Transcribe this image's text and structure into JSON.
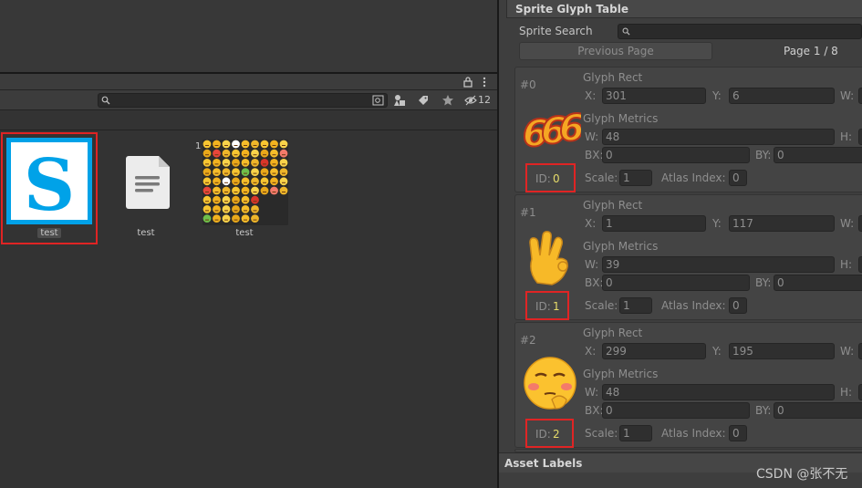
{
  "project": {
    "hidden_count": "12",
    "search_value": "",
    "assets": [
      {
        "label": "test",
        "kind": "sprite",
        "letter": "S"
      },
      {
        "label": "test",
        "kind": "document"
      },
      {
        "label": "test",
        "kind": "texture",
        "badge": "1"
      }
    ]
  },
  "inspector": {
    "title": "Sprite Glyph Table",
    "search_label": "Sprite Search",
    "search_value": "",
    "prev_page": "Previous Page",
    "page_label": "Page 1 / 8",
    "section_rect": "Glyph Rect",
    "section_metrics": "Glyph Metrics",
    "labels": {
      "x": "X:",
      "y": "Y:",
      "w": "W:",
      "h": "H:",
      "bx": "BX:",
      "by": "BY:",
      "id": "ID:",
      "scale": "Scale:",
      "atlas": "Atlas Index:"
    },
    "glyphs": [
      {
        "index": "#0",
        "id": "0",
        "x": "301",
        "y": "6",
        "w": "48",
        "bx": "0",
        "by": "0",
        "scale": "1",
        "atlas": "0",
        "image": "666-emoji"
      },
      {
        "index": "#1",
        "id": "1",
        "x": "1",
        "y": "117",
        "w": "39",
        "bx": "0",
        "by": "0",
        "scale": "1",
        "atlas": "0",
        "image": "ok-hand-emoji"
      },
      {
        "index": "#2",
        "id": "2",
        "x": "299",
        "y": "195",
        "w": "48",
        "bx": "0",
        "by": "0",
        "scale": "1",
        "atlas": "0",
        "image": "smug-face-emoji"
      }
    ],
    "asset_labels": "Asset Labels"
  },
  "watermark": "CSDN @张不无",
  "colors": {
    "highlight": "#e02424",
    "id_value": "#e6dc6a",
    "sprite_blue": "#00a2e8"
  }
}
